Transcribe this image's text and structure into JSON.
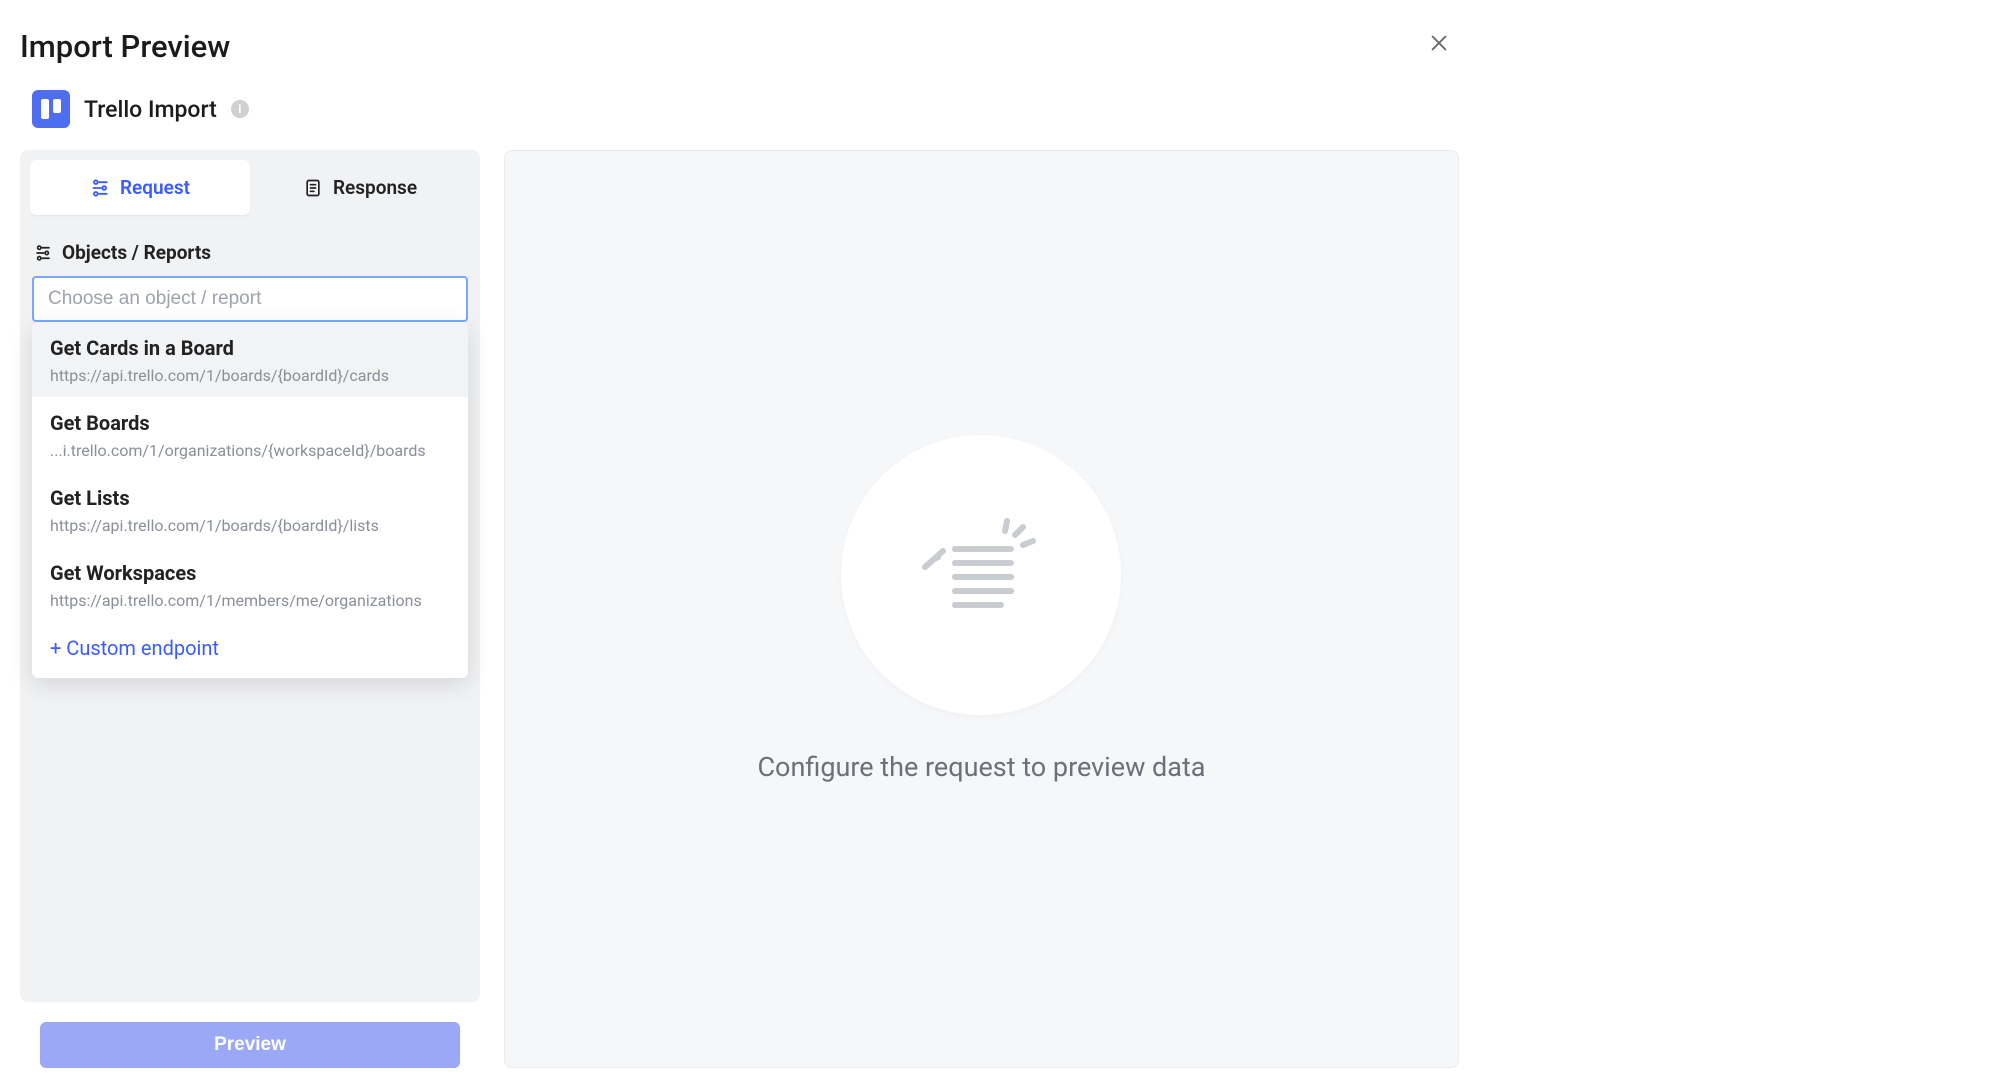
{
  "header": {
    "title": "Import Preview",
    "source_name": "Trello Import"
  },
  "tabs": {
    "request_label": "Request",
    "response_label": "Response"
  },
  "sidebar": {
    "section_label": "Objects / Reports",
    "input_placeholder": "Choose an object / report",
    "custom_endpoint_label": "+ Custom endpoint",
    "options": [
      {
        "title": "Get Cards in a Board",
        "sub": "https://api.trello.com/1/boards/{boardId}/cards"
      },
      {
        "title": "Get Boards",
        "sub": "...i.trello.com/1/organizations/{workspaceId}/boards"
      },
      {
        "title": "Get Lists",
        "sub": "https://api.trello.com/1/boards/{boardId}/lists"
      },
      {
        "title": "Get Workspaces",
        "sub": "https://api.trello.com/1/members/me/organizations"
      }
    ]
  },
  "buttons": {
    "preview_label": "Preview"
  },
  "main": {
    "empty_message": "Configure the request to preview data"
  }
}
